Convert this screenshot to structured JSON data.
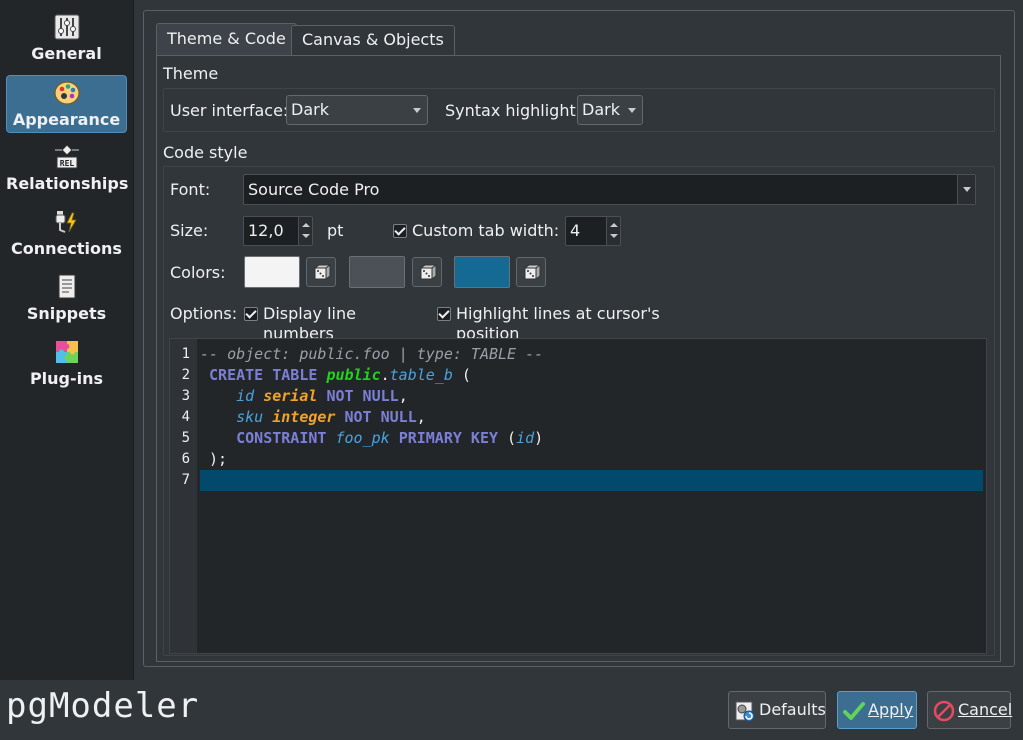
{
  "sidebar": {
    "items": [
      {
        "label": "General",
        "icon": "sliders-icon"
      },
      {
        "label": "Appearance",
        "icon": "palette-icon"
      },
      {
        "label": "Relationships",
        "icon": "relationship-icon"
      },
      {
        "label": "Connections",
        "icon": "plug-icon"
      },
      {
        "label": "Snippets",
        "icon": "snippet-icon"
      },
      {
        "label": "Plug-ins",
        "icon": "puzzle-icon"
      }
    ],
    "active": "Appearance"
  },
  "tabs": [
    "Theme & Code",
    "Canvas & Objects"
  ],
  "theme": {
    "group_title": "Theme",
    "ui_label": "User interface:",
    "ui_value": "Dark",
    "syntax_label": "Syntax highlight:",
    "syntax_value": "Dark"
  },
  "code_style": {
    "group_title": "Code style",
    "font_label": "Font:",
    "font_value": "Source Code Pro",
    "size_label": "Size:",
    "size_value": "12,0",
    "size_unit": "pt",
    "custom_tab_label": "Custom tab width:",
    "custom_tab_checked": true,
    "tab_width_value": "4",
    "colors_label": "Colors:",
    "colors": [
      "#f4f4f4",
      "#4b5156",
      "#156a94"
    ],
    "options_label": "Options:",
    "opt_line_numbers": "Display line numbers",
    "opt_highlight": "Highlight lines at cursor's position"
  },
  "editor": {
    "line_numbers": [
      "1",
      "2",
      "3",
      "4",
      "5",
      "6",
      "7"
    ],
    "lines": [
      [
        {
          "t": "-- object: public.foo | type: TABLE --",
          "c": "cmt"
        }
      ],
      [
        {
          "t": " ",
          "c": ""
        },
        {
          "t": "CREATE TABLE",
          "c": "kw"
        },
        {
          "t": " ",
          "c": ""
        },
        {
          "t": "public",
          "c": "sch"
        },
        {
          "t": ".",
          "c": ""
        },
        {
          "t": "table_b",
          "c": "obj"
        },
        {
          "t": " (",
          "c": ""
        }
      ],
      [
        {
          "t": "    ",
          "c": ""
        },
        {
          "t": "id",
          "c": "obj"
        },
        {
          "t": " ",
          "c": ""
        },
        {
          "t": "serial",
          "c": "typ"
        },
        {
          "t": " ",
          "c": ""
        },
        {
          "t": "NOT NULL",
          "c": "kw"
        },
        {
          "t": ",",
          "c": ""
        }
      ],
      [
        {
          "t": "    ",
          "c": ""
        },
        {
          "t": "sku",
          "c": "obj"
        },
        {
          "t": " ",
          "c": ""
        },
        {
          "t": "integer",
          "c": "typ"
        },
        {
          "t": " ",
          "c": ""
        },
        {
          "t": "NOT NULL",
          "c": "kw"
        },
        {
          "t": ",",
          "c": ""
        }
      ],
      [
        {
          "t": "    ",
          "c": ""
        },
        {
          "t": "CONSTRAINT",
          "c": "kw"
        },
        {
          "t": " ",
          "c": ""
        },
        {
          "t": "foo_pk",
          "c": "obj"
        },
        {
          "t": " ",
          "c": ""
        },
        {
          "t": "PRIMARY KEY",
          "c": "kw"
        },
        {
          "t": " (",
          "c": ""
        },
        {
          "t": "id",
          "c": "obj"
        },
        {
          "t": ")",
          "c": ""
        }
      ],
      [
        {
          "t": " );",
          "c": ""
        }
      ],
      [
        {
          "t": "",
          "c": ""
        }
      ]
    ]
  },
  "brand": "pgModeler",
  "buttons": {
    "defaults": "Defaults",
    "apply": "Apply",
    "cancel": "Cancel"
  }
}
